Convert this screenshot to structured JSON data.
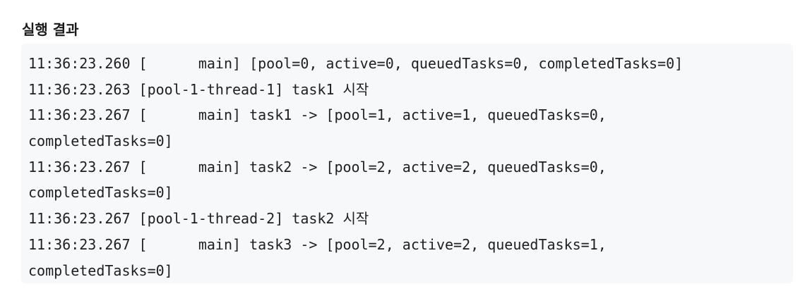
{
  "heading": "실행 결과",
  "output_lines": [
    "11:36:23.260 [      main] [pool=0, active=0, queuedTasks=0, completedTasks=0]",
    "11:36:23.263 [pool-1-thread-1] task1 시작",
    "11:36:23.267 [      main] task1 -> [pool=1, active=1, queuedTasks=0,",
    "completedTasks=0]",
    "11:36:23.267 [      main] task2 -> [pool=2, active=2, queuedTasks=0,",
    "completedTasks=0]",
    "11:36:23.267 [pool-1-thread-2] task2 시작",
    "11:36:23.267 [      main] task3 -> [pool=2, active=2, queuedTasks=1,",
    "completedTasks=0]"
  ],
  "colors": {
    "code_background": "#f7f8f9",
    "text": "#1f1f1f"
  }
}
